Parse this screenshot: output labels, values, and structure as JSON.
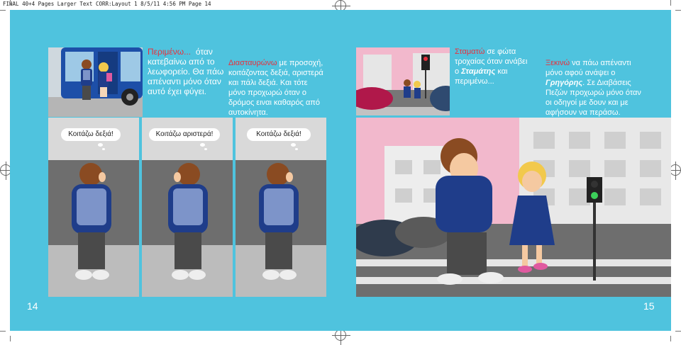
{
  "slug": "FINAL 40+4 Pages Larger Text  CORR:Layout 1  8/5/11  4:56 PM  Page 14",
  "left_page": {
    "para1": {
      "em": "Περιμένω...",
      "lines": [
        "όταν",
        "κατεβαίνω από το",
        "λεωφορείο. Θα πάω",
        "απέναντι μόνο όταν",
        "αυτό έχει φύγει."
      ]
    },
    "para2": {
      "em": "Διασταυρώνω",
      "lines": [
        "με προσοχή,",
        "κοιτάζοντας δεξιά, αριστερά",
        "και πάλι δεξιά. Και τότε",
        "μόνο προχωρώ όταν ο",
        "δρόμος ειναι  καθαρός από",
        "αυτοκίνητα."
      ]
    },
    "bubbles": [
      "Κοιτάζω δεξιά!",
      "Κοιτάζω αριστερά!",
      "Κοιτάζω δεξιά!"
    ],
    "page_number": "14"
  },
  "right_page": {
    "para1": {
      "em": "Σταματώ",
      "lines": [
        "σε φώτα",
        "τροχαίας όταν ανάβει",
        "ο",
        "Σταμάτης",
        "και",
        "περιμένω..."
      ]
    },
    "para2": {
      "em": "Ξεκινώ",
      "lines": [
        "να πάω απέναντι",
        "μόνο αφού ανάψει ο",
        "Γρηγόρης",
        ". Σε Διαβάσεις",
        "Πεζών προχωρώ μόνο όταν",
        "οι οδηγοί με δουν και με",
        "αφήσουν να περάσω."
      ]
    },
    "page_number": "15"
  },
  "colors": {
    "page_bg": "#4fc3de",
    "accent_red": "#e8303d",
    "jacket": "#1f3d8a",
    "backpack": "#7d94c9",
    "pants": "#4a4a4a",
    "hair": "#8a4b22",
    "pavement": "#b5b5b5"
  }
}
